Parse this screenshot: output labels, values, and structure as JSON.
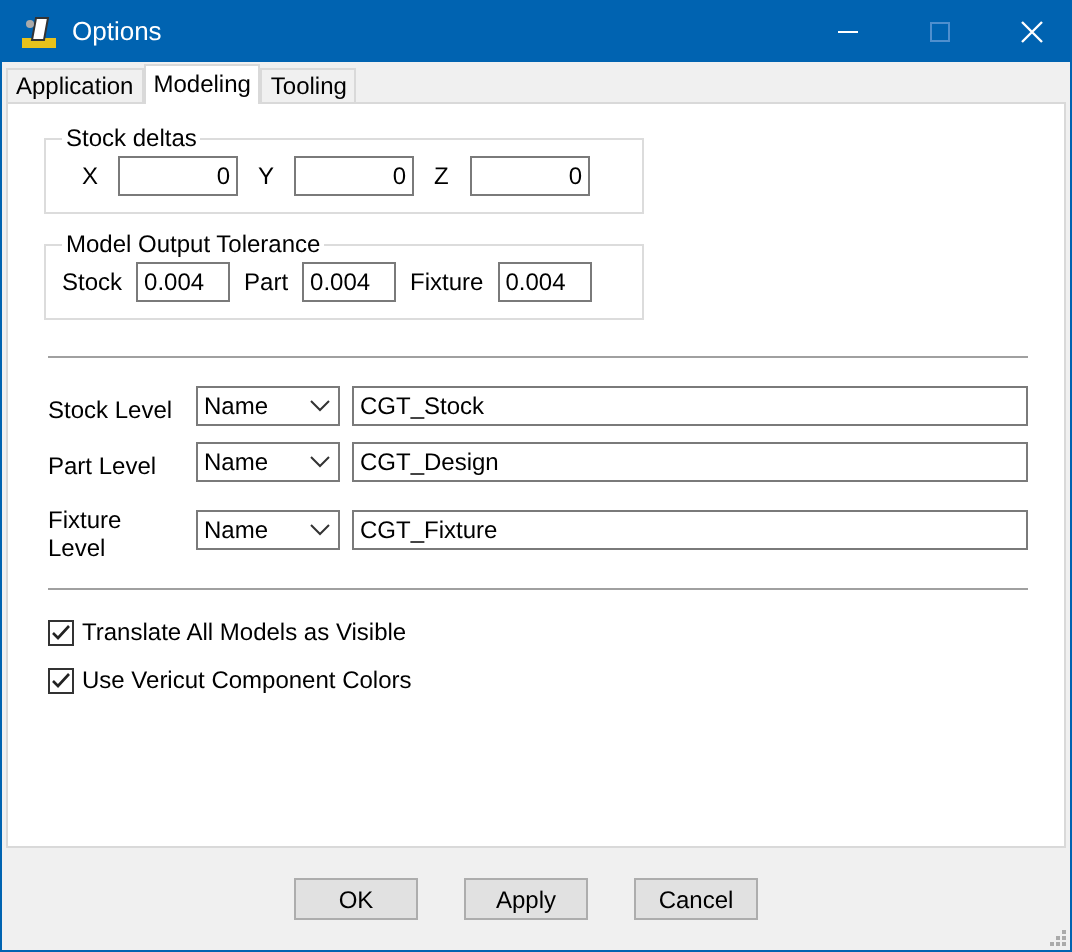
{
  "window": {
    "title": "Options"
  },
  "tabs": [
    {
      "label": "Application",
      "selected": false
    },
    {
      "label": "Modeling",
      "selected": true
    },
    {
      "label": "Tooling",
      "selected": false
    }
  ],
  "stock_deltas": {
    "title": "Stock deltas",
    "fields": [
      {
        "label": "X",
        "value": "0"
      },
      {
        "label": "Y",
        "value": "0"
      },
      {
        "label": "Z",
        "value": "0"
      }
    ]
  },
  "model_output_tolerance": {
    "title": "Model Output Tolerance",
    "fields": [
      {
        "label": "Stock",
        "value": "0.004"
      },
      {
        "label": "Part",
        "value": "0.004"
      },
      {
        "label": "Fixture",
        "value": "0.004"
      }
    ]
  },
  "levels": [
    {
      "label": "Stock Level",
      "mode": "Name",
      "value": "CGT_Stock"
    },
    {
      "label": "Part Level",
      "mode": "Name",
      "value": "CGT_Design"
    },
    {
      "label": "Fixture Level",
      "mode": "Name",
      "value": "CGT_Fixture"
    }
  ],
  "checkboxes": [
    {
      "label": "Translate All Models as Visible",
      "checked": true
    },
    {
      "label": "Use Vericut Component Colors",
      "checked": true
    }
  ],
  "buttons": [
    "OK",
    "Apply",
    "Cancel"
  ]
}
